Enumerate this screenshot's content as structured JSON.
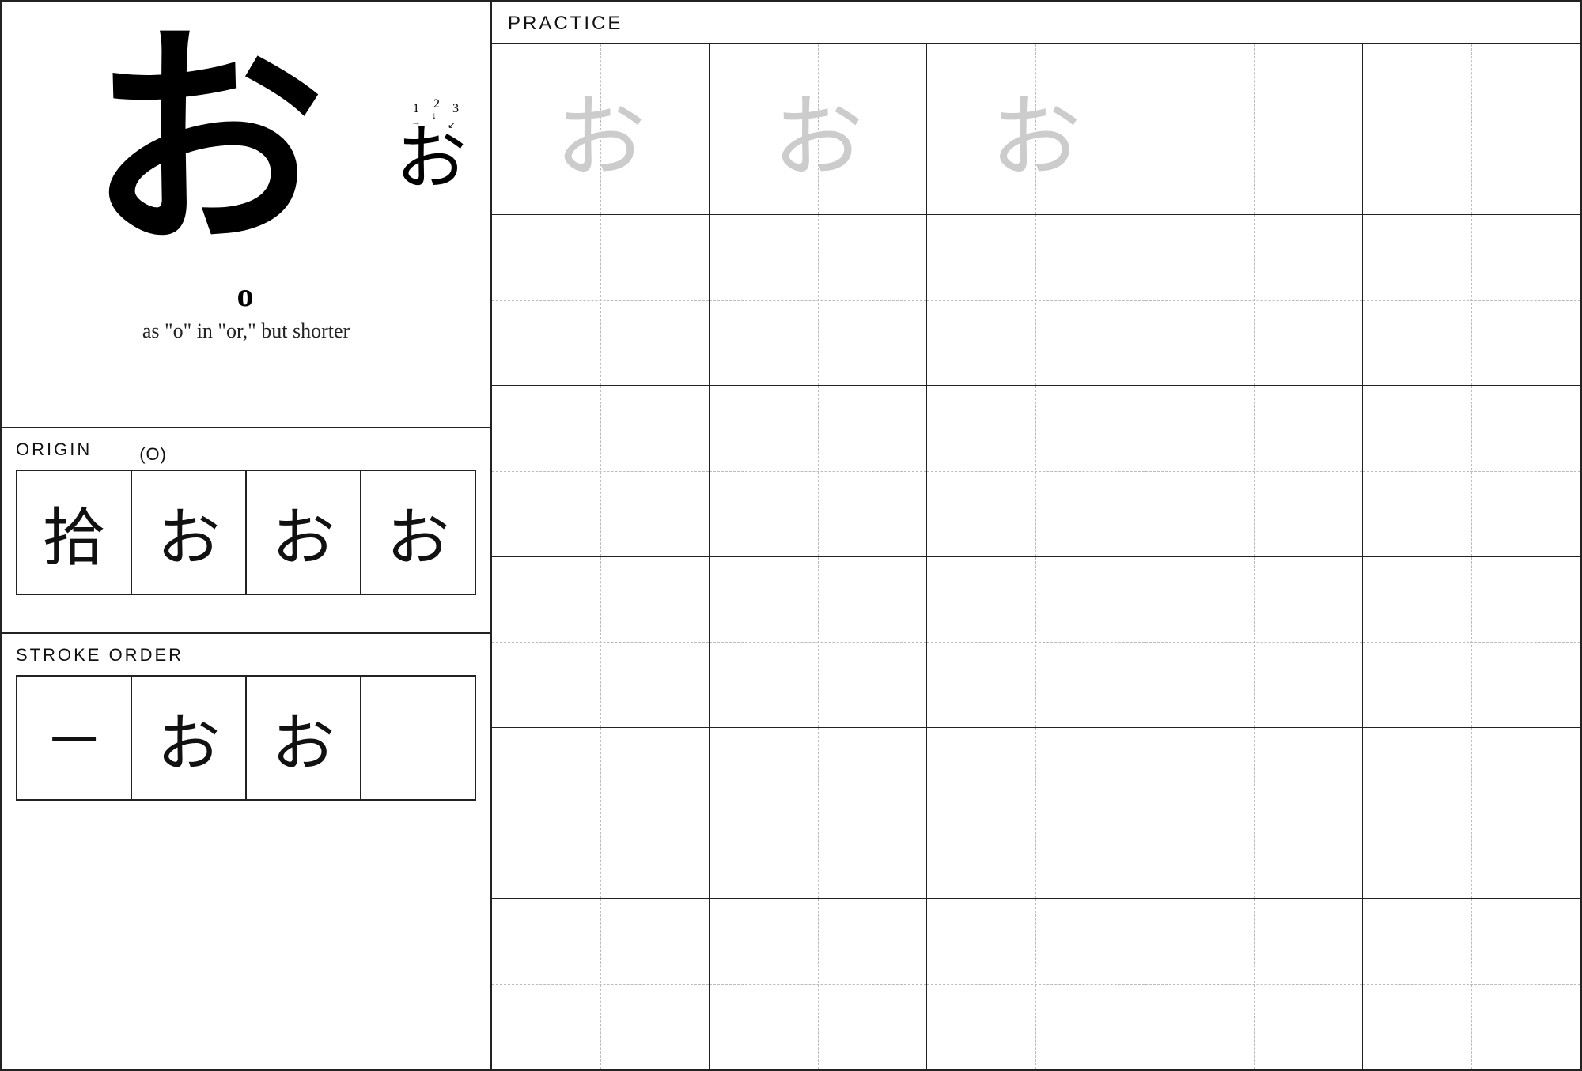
{
  "left": {
    "main_char": "お",
    "stroke_guide_char": "お",
    "romaji": "o",
    "pronunciation_desc": "as \"o\" in \"or,\" but shorter",
    "origin_label": "ORIGIN",
    "origin_kanji": "(O)",
    "origin_chars": [
      "拾",
      "お",
      "お",
      "お"
    ],
    "stroke_order_label": "STROKE ORDER",
    "stroke_chars": [
      "一",
      "お",
      "お",
      ""
    ]
  },
  "right": {
    "practice_label": "PRACTICE",
    "practice_chars": [
      "お",
      "お",
      "お",
      "",
      "",
      "",
      "",
      "",
      "",
      "",
      "",
      "",
      "",
      "",
      "",
      "",
      "",
      "",
      "",
      "",
      "",
      "",
      "",
      "",
      "",
      "",
      "",
      "",
      "",
      ""
    ]
  }
}
